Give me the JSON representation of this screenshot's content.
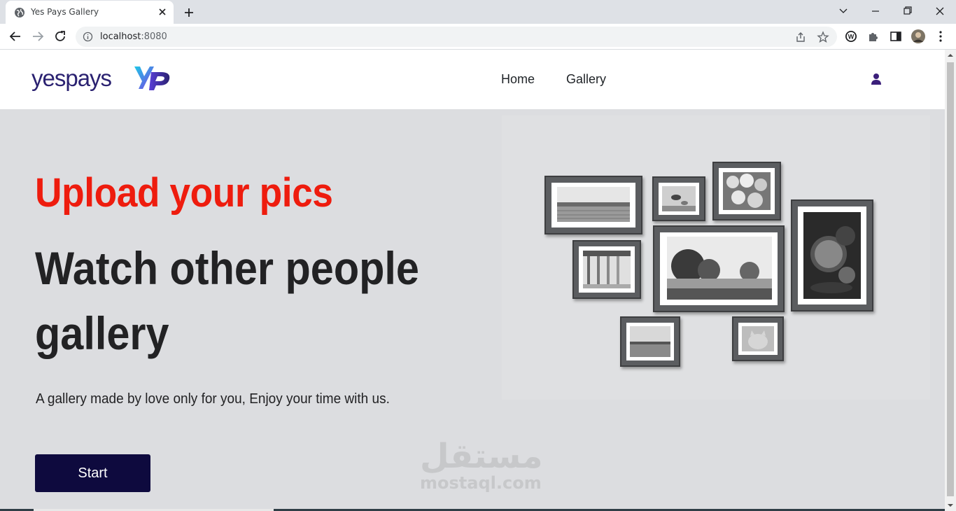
{
  "browser": {
    "tab_title": "Yes Pays Gallery",
    "url_host": "localhost",
    "url_port": ":8080",
    "favicon": "globe-icon",
    "toolbar_icons": [
      "back-icon",
      "forward-icon",
      "reload-icon",
      "share-icon",
      "star-icon",
      "wordpress-icon",
      "extensions-icon",
      "sidepanel-icon",
      "profile-avatar",
      "menu-icon"
    ]
  },
  "navbar": {
    "logo_text": "yespays",
    "links": [
      {
        "label": "Home"
      },
      {
        "label": "Gallery"
      }
    ],
    "user_icon": "user-icon"
  },
  "hero": {
    "headline": "Upload your pics",
    "subheadline": "Watch other people gallery",
    "description": "A gallery made by love only for you, Enjoy your time with us.",
    "button": "Start"
  },
  "watermark": {
    "arabic": "مستقل",
    "latin": "mostaql.com"
  },
  "colors": {
    "headline": "#ee1c0e",
    "text": "#222224",
    "button_bg": "#0e0a3e",
    "brand": "#2b2271",
    "page_bg": "#dcdde0"
  }
}
